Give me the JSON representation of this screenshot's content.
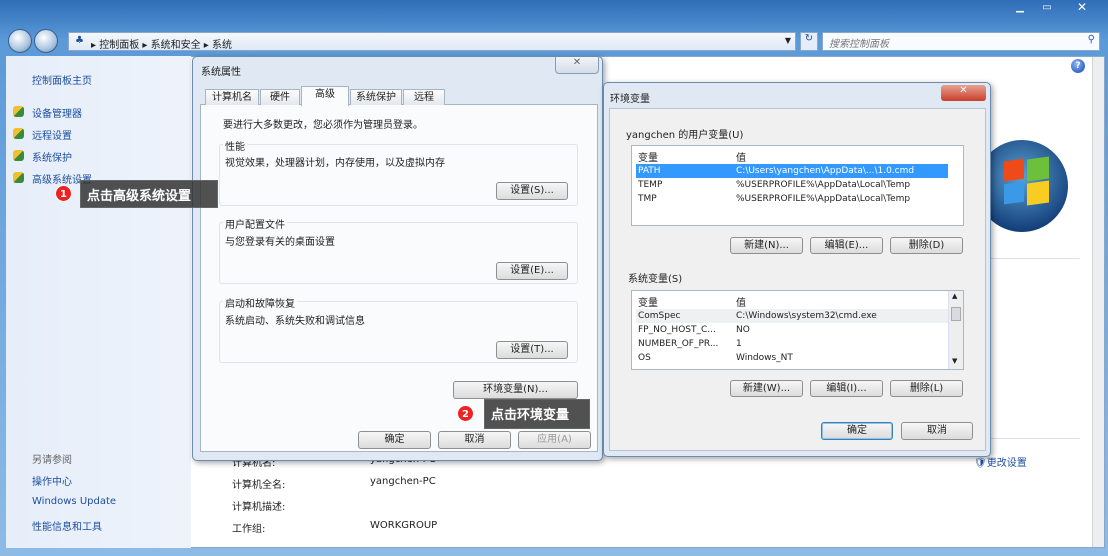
{
  "window": {
    "breadcrumb": [
      "控制面板",
      "系统和安全",
      "系统"
    ],
    "search_placeholder": "搜索控制面板"
  },
  "sidebar": {
    "home": "控制面板主页",
    "items": [
      {
        "label": "设备管理器"
      },
      {
        "label": "远程设置"
      },
      {
        "label": "系统保护"
      },
      {
        "label": "高级系统设置"
      }
    ],
    "see_also": "另请参阅",
    "links": [
      "操作中心",
      "Windows Update",
      "性能信息和工具"
    ]
  },
  "main": {
    "rows": [
      {
        "label": "计算机名:",
        "value": "yangchen-PC"
      },
      {
        "label": "计算机全名:",
        "value": "yangchen-PC"
      },
      {
        "label": "计算机描述:",
        "value": ""
      },
      {
        "label": "工作组:",
        "value": "WORKGROUP"
      }
    ],
    "change_settings": "更改设置"
  },
  "callouts": [
    {
      "num": "1",
      "text": "点击高级系统设置"
    },
    {
      "num": "2",
      "text": "点击环境变量"
    }
  ],
  "sysprops": {
    "title": "系统属性",
    "tabs": [
      "计算机名",
      "硬件",
      "高级",
      "系统保护",
      "远程"
    ],
    "selected_tab": "高级",
    "intro": "要进行大多数更改，您必须作为管理员登录。",
    "groups": [
      {
        "title": "性能",
        "desc": "视觉效果，处理器计划，内存使用，以及虚拟内存",
        "button": "设置(S)..."
      },
      {
        "title": "用户配置文件",
        "desc": "与您登录有关的桌面设置",
        "button": "设置(E)..."
      },
      {
        "title": "启动和故障恢复",
        "desc": "系统启动、系统失败和调试信息",
        "button": "设置(T)..."
      }
    ],
    "env_button": "环境变量(N)...",
    "ok": "确定",
    "cancel": "取消",
    "apply": "应用(A)"
  },
  "envvars": {
    "title": "环境变量",
    "user_label": "yangchen 的用户变量(U)",
    "col_var": "变量",
    "col_val": "值",
    "user_rows": [
      {
        "var": "PATH",
        "val": "C:\\Users\\yangchen\\AppData\\...\\1.0.cmd"
      },
      {
        "var": "TEMP",
        "val": "%USERPROFILE%\\AppData\\Local\\Temp"
      },
      {
        "var": "TMP",
        "val": "%USERPROFILE%\\AppData\\Local\\Temp"
      }
    ],
    "user_buttons": [
      "新建(N)...",
      "编辑(E)...",
      "删除(D)"
    ],
    "sys_label": "系统变量(S)",
    "sys_rows": [
      {
        "var": "ComSpec",
        "val": "C:\\Windows\\system32\\cmd.exe"
      },
      {
        "var": "FP_NO_HOST_C...",
        "val": "NO"
      },
      {
        "var": "NUMBER_OF_PR...",
        "val": "1"
      },
      {
        "var": "OS",
        "val": "Windows_NT"
      }
    ],
    "sys_buttons": [
      "新建(W)...",
      "编辑(I)...",
      "删除(L)"
    ],
    "ok": "确定",
    "cancel": "取消"
  },
  "colors": {
    "selection": "#3399ff",
    "callout_badge": "#e22222",
    "link": "#1e4fa0"
  }
}
